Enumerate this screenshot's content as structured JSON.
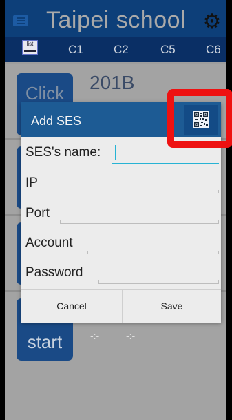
{
  "header": {
    "title": "Taipei school",
    "menu_icon": "list-icon",
    "settings_icon": "gear-icon"
  },
  "tabs": {
    "list_label": "list",
    "items": [
      "C1",
      "C2",
      "C5",
      "C6"
    ]
  },
  "background": {
    "room_name": "201B",
    "click_label": "Click",
    "start_label": "start",
    "time_placeholder_1": "-:-",
    "time_placeholder_2": "-:-"
  },
  "dialog": {
    "title": "Add SES",
    "qr_icon": "qr-code-icon",
    "fields": [
      {
        "label": "SES's name:",
        "value": ""
      },
      {
        "label": "IP",
        "value": ""
      },
      {
        "label": "Port",
        "value": ""
      },
      {
        "label": "Account",
        "value": ""
      },
      {
        "label": "Password",
        "value": ""
      }
    ],
    "cancel_label": "Cancel",
    "save_label": "Save"
  },
  "colors": {
    "header_bg": "#0d3f79",
    "dialog_header_bg": "#1d5b94",
    "highlight": "#ee1111",
    "focus_accent": "#27b3d4"
  }
}
